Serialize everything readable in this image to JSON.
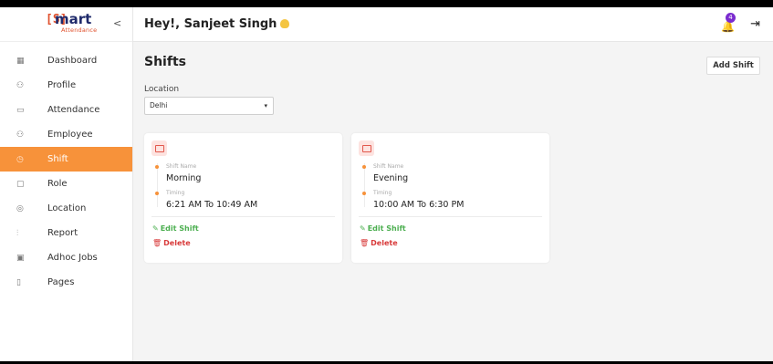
{
  "app": {
    "logo_bracket": "[S]",
    "logo_main": "mart",
    "logo_sub": "Attendance",
    "collapse_glyph": "<"
  },
  "header": {
    "greeting": "Hey!, Sanjeet Singh",
    "notification_count": "4",
    "bell_glyph": "🔔",
    "logout_glyph": "⇥"
  },
  "sidebar": {
    "items": [
      {
        "label": "Dashboard",
        "icon": "▦"
      },
      {
        "label": "Profile",
        "icon": "⚇"
      },
      {
        "label": "Attendance",
        "icon": "▭"
      },
      {
        "label": "Employee",
        "icon": "⚇"
      },
      {
        "label": "Shift",
        "icon": "◷"
      },
      {
        "label": "Role",
        "icon": "▢"
      },
      {
        "label": "Location",
        "icon": "◎"
      },
      {
        "label": "Report",
        "icon": "⫶"
      },
      {
        "label": "Adhoc Jobs",
        "icon": "▣"
      },
      {
        "label": "Pages",
        "icon": "▯"
      }
    ],
    "active": "Shift",
    "accent_color": "#f7923a"
  },
  "main": {
    "title": "Shifts",
    "add_button": "Add Shift",
    "location_label": "Location",
    "location_value": "Delhi",
    "select_caret": "▾"
  },
  "shifts": [
    {
      "name_label": "Shift Name",
      "name": "Morning",
      "timing_label": "Timing",
      "timing": "6:21 AM To 10:49 AM",
      "edit_label": "Edit Shift",
      "delete_label": "Delete"
    },
    {
      "name_label": "Shift Name",
      "name": "Evening",
      "timing_label": "Timing",
      "timing": "10:00 AM To 6:30 PM",
      "edit_label": "Edit Shift",
      "delete_label": "Delete"
    }
  ],
  "colors": {
    "edit": "#4caf50",
    "delete": "#d83a3a",
    "badge": "#7b2ccf"
  }
}
